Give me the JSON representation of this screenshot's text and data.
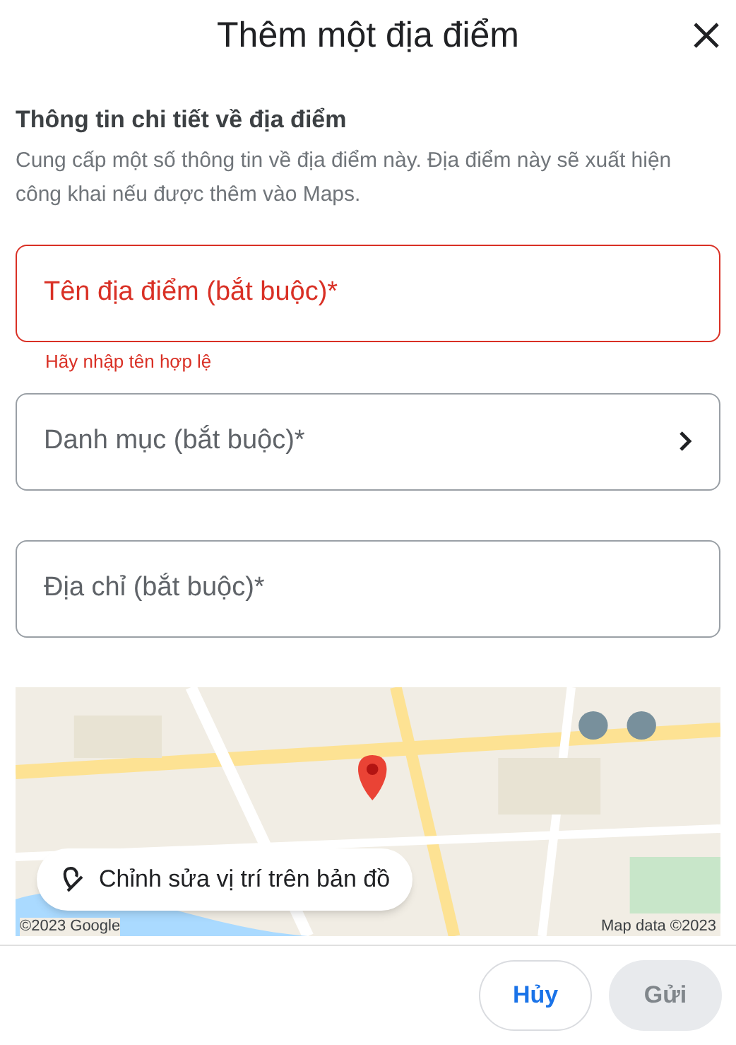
{
  "dialog": {
    "title": "Thêm một địa điểm"
  },
  "section": {
    "heading": "Thông tin chi tiết về địa điểm",
    "description": "Cung cấp một số thông tin về địa điểm này. Địa điểm này sẽ xuất hiện công khai nếu được thêm vào Maps."
  },
  "fields": [
    {
      "kind": "text",
      "placeholder": "Tên địa điểm (bắt buộc)*",
      "invalid": true,
      "error": "Hãy nhập tên hợp lệ"
    },
    {
      "kind": "select",
      "placeholder": "Danh mục (bắt buộc)*",
      "invalid": false
    },
    {
      "kind": "text",
      "placeholder": "Địa chỉ (bắt buộc)*",
      "invalid": false
    }
  ],
  "map": {
    "kind": "picture",
    "edit_button": "Chỉnh sửa vị trí trên bản đồ",
    "copyright": "©2023 Google",
    "map_data": "Map data ©2023"
  },
  "buttons": [
    {
      "label": "Hủy",
      "disabled": false
    },
    {
      "label": "Gửi",
      "disabled": true
    }
  ]
}
